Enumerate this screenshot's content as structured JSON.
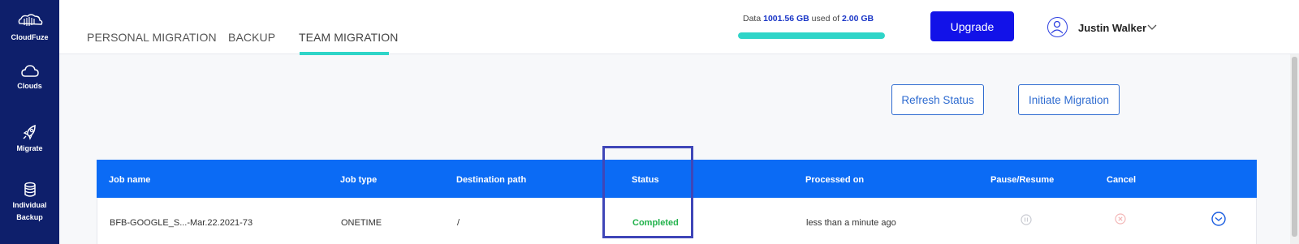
{
  "sidebar": {
    "brand": "CloudFuze",
    "items": [
      {
        "label": "Clouds",
        "icon": "cloud-icon"
      },
      {
        "label": "Migrate",
        "icon": "rocket-icon"
      },
      {
        "label_line1": "Individual",
        "label_line2": "Backup",
        "icon": "database-icon"
      }
    ]
  },
  "tabs": [
    {
      "label": "PERSONAL MIGRATION",
      "active": false
    },
    {
      "label": "BACKUP",
      "active": false
    },
    {
      "label": "TEAM MIGRATION",
      "active": true
    }
  ],
  "quota": {
    "prefix": "Data",
    "used": "1001.56 GB",
    "middle": "used of",
    "total": "2.00 GB",
    "fill_fraction": 1.0
  },
  "upgrade_label": "Upgrade",
  "user": {
    "name": "Justin Walker"
  },
  "actions": {
    "refresh_label": "Refresh Status",
    "initiate_label": "Initiate Migration"
  },
  "table": {
    "headers": {
      "job_name": "Job name",
      "job_type": "Job type",
      "destination": "Destination path",
      "status": "Status",
      "processed": "Processed on",
      "pause": "Pause/Resume",
      "cancel": "Cancel"
    },
    "rows": [
      {
        "job_name": "BFB-GOOGLE_S...-Mar.22.2021-73",
        "job_type": "ONETIME",
        "destination": "/",
        "status": "Completed",
        "processed": "less than a minute ago"
      }
    ]
  },
  "colors": {
    "sidebar": "#0e1f6b",
    "accent": "#0b6bf5",
    "teal": "#2fd5c8",
    "status_completed": "#21b24b",
    "highlight": "#3f46b8"
  }
}
